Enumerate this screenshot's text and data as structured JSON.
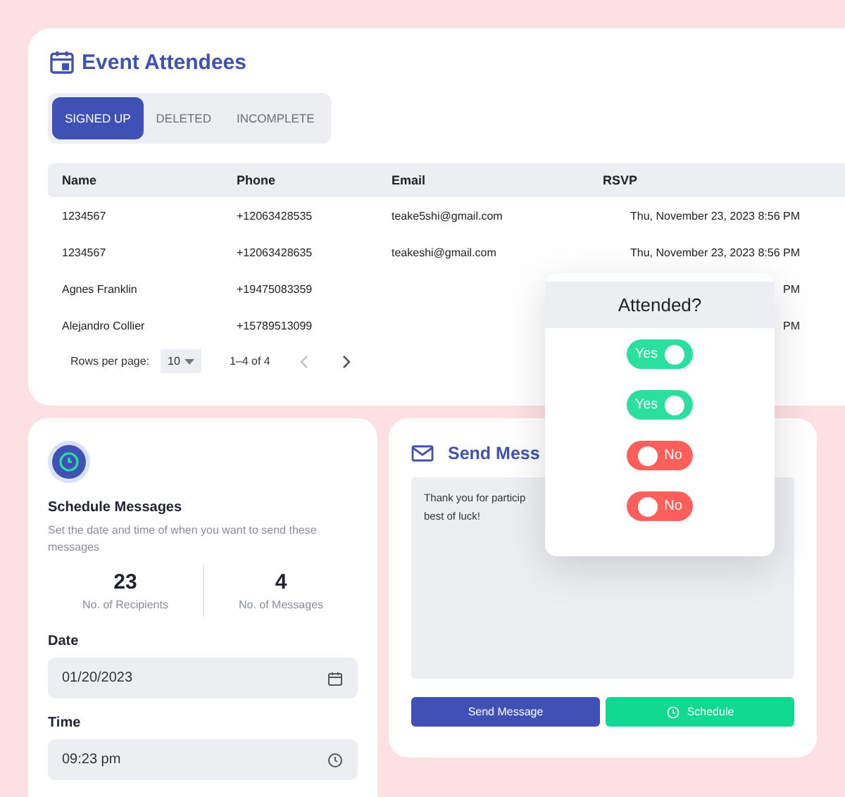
{
  "attendees_card": {
    "title": "Event Attendees",
    "tabs": [
      {
        "label": "SIGNED UP",
        "selected": true
      },
      {
        "label": "DELETED",
        "selected": false
      },
      {
        "label": "INCOMPLETE",
        "selected": false
      }
    ],
    "table": {
      "columns": [
        "Name",
        "Phone",
        "Email",
        "RSVP"
      ],
      "rows": [
        [
          "1234567",
          "+12063428535",
          "teake5shi@gmail.com",
          "Thu, November 23, 2023 8:56 PM"
        ],
        [
          "1234567",
          "+12063428635",
          "teakeshi@gmail.com",
          "Thu, November 23, 2023 8:56 PM"
        ],
        [
          "Agnes Franklin",
          "+19475083359",
          "",
          "PM"
        ],
        [
          "Alejandro Collier",
          "+15789513099",
          "",
          "PM"
        ]
      ]
    },
    "pagination": {
      "rows_label": "Rows per page:",
      "rows_value": "10",
      "range": "1–4 of 4",
      "prev_disabled": true,
      "next_disabled": false
    }
  },
  "attended_popup": {
    "title": "Attended?",
    "toggles": [
      {
        "label": "Yes",
        "on": true
      },
      {
        "label": "Yes",
        "on": true
      },
      {
        "label": "No",
        "on": false
      },
      {
        "label": "No",
        "on": false
      }
    ]
  },
  "schedule_card": {
    "title": "Schedule Messages",
    "description": "Set the date and time of when you want to send these messages",
    "stats": [
      {
        "value": "23",
        "label": "No. of Recipients"
      },
      {
        "value": "4",
        "label": "No. of Messages"
      }
    ],
    "date_label": "Date",
    "date_value": "01/20/2023",
    "time_label": "Time",
    "time_value": "09:23 pm"
  },
  "message_card": {
    "title": "Send Mess",
    "message_lines": [
      "Thank you for particip",
      "best of luck!"
    ],
    "buttons": [
      {
        "label": "Send Message",
        "kind": "primary"
      },
      {
        "label": "Schedule",
        "kind": "schedule"
      }
    ]
  }
}
